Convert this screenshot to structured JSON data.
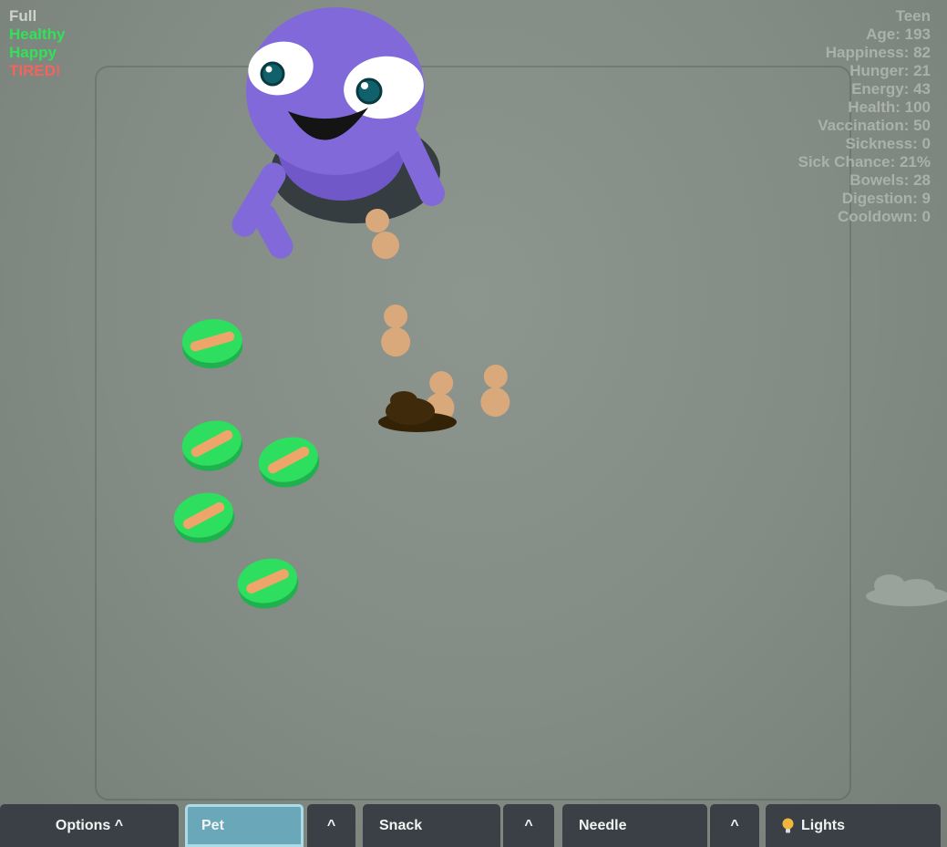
{
  "colors": {
    "bg-center": "#8d958f",
    "bg-mid": "#838b85",
    "bg-edge": "#767e78",
    "pen-border": "rgba(30,40,32,0.18)",
    "stats-gray": "#a9b1ab",
    "pet-purple": "#8169d9",
    "pet-purple-dark": "#7158c8",
    "hole-dark": "#363d41",
    "eye-white": "#ffffff",
    "iris-teal": "#11616c",
    "iris-ring": "#083a40",
    "mouth-black": "#141414",
    "fruit-green": "#2ede5e",
    "fruit-green-dark": "#1fb14d",
    "fruit-orange": "#eda569",
    "peanut-tan": "#d9a97c",
    "poop-brown": "#3f2a0b",
    "poop-brown-dark": "#342207",
    "cloud-gray": "#99a29b",
    "button-bg": "#3a4045",
    "button-text": "#f2f4f4",
    "active-bg": "#6aa8b9",
    "active-border": "#abdbe7",
    "bulb-yellow": "#f2b63c"
  },
  "status_panel": {
    "lines": [
      {
        "text": "Full",
        "color": "#cdd2cd"
      },
      {
        "text": "Healthy",
        "color": "#31e257"
      },
      {
        "text": "Happy",
        "color": "#31e257"
      },
      {
        "text": "TIRED!",
        "color": "#f4635c"
      }
    ]
  },
  "stats_panel": {
    "color": "#a9b1ab",
    "lines": [
      "Teen",
      "Age: 193",
      "Happiness: 82",
      "Hunger: 21",
      "Energy: 43",
      "Health: 100",
      "Vaccination: 50",
      "Sickness: 0",
      "Sick Chance: 21%",
      "Bowels: 28",
      "Digestion: 9",
      "Cooldown: 0"
    ]
  },
  "toolbar": {
    "buttons": {
      "options": {
        "label": "Options ^"
      },
      "pet": {
        "label": "Pet",
        "active": true
      },
      "pet_caret": {
        "label": "^"
      },
      "snack": {
        "label": "Snack"
      },
      "snack_caret": {
        "label": "^"
      },
      "needle": {
        "label": "Needle"
      },
      "needle_caret": {
        "label": "^"
      },
      "lights": {
        "label": "Lights",
        "icon": "lightbulb"
      }
    }
  },
  "scene": {
    "pet": "purple blob pet in hole (Teen)",
    "melon_slices": 5,
    "peanut_droppings": 4,
    "poop_piles": 1,
    "dust_clouds": 1
  }
}
